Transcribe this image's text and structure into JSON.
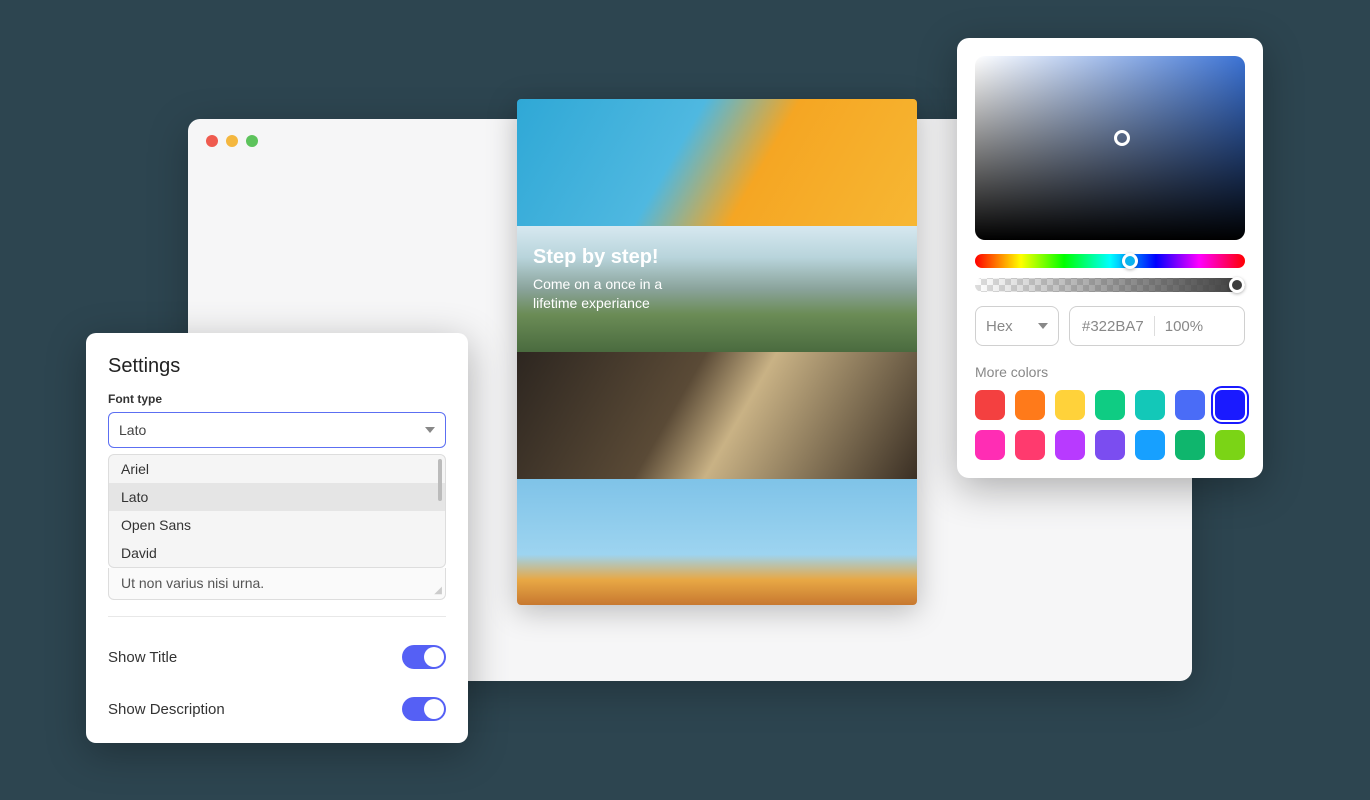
{
  "settings": {
    "title": "Settings",
    "font_type_label": "Font type",
    "font_selected": "Lato",
    "font_options": [
      "Ariel",
      "Lato",
      "Open Sans",
      "David"
    ],
    "textarea_text": "Ut non varius nisi urna.",
    "show_title_label": "Show Title",
    "show_description_label": "Show Description",
    "show_title_on": true,
    "show_description_on": true
  },
  "preview": {
    "title": "Step by step!",
    "subtitle_line1": "Come on a once in a",
    "subtitle_line2": "lifetime experiance"
  },
  "color_picker": {
    "format_label": "Hex",
    "hex_value": "#322BA7",
    "alpha_pct": "100%",
    "more_colors_label": "More colors",
    "swatches": [
      "#f44040",
      "#ff7a1a",
      "#ffd23a",
      "#0fcc83",
      "#13c8b8",
      "#4a6cf7",
      "#1a1aff",
      "#ff2db4",
      "#ff3a6e",
      "#b83aff",
      "#7b4df0",
      "#17a0ff",
      "#0fb66d",
      "#7bd416"
    ],
    "selected_swatch_index": 6
  }
}
